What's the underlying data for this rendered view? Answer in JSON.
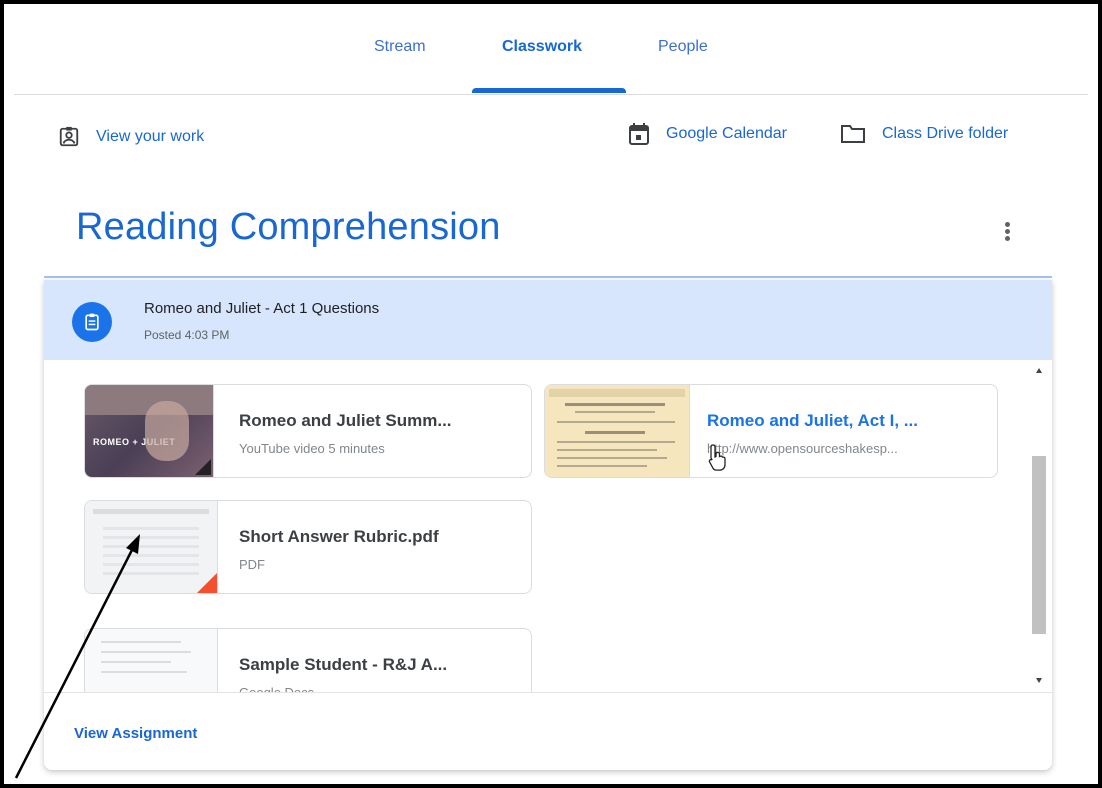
{
  "nav": {
    "tabs": [
      {
        "label": "Stream"
      },
      {
        "label": "Classwork"
      },
      {
        "label": "People"
      }
    ],
    "active_tab": "Classwork"
  },
  "toolbar": {
    "view_work_label": "View your work",
    "calendar_label": "Google Calendar",
    "drive_label": "Class Drive folder"
  },
  "topic": {
    "title": "Reading Comprehension"
  },
  "assignment": {
    "title": "Romeo and Juliet - Act 1 Questions",
    "posted": "Posted 4:03 PM",
    "attachments": [
      {
        "title": "Romeo and Juliet Summ...",
        "subtitle": "YouTube video  5 minutes",
        "kind": "youtube",
        "thumb_text": "ROMEO + JULIET"
      },
      {
        "title": "Romeo and Juliet, Act I, ...",
        "subtitle": "http://www.opensourceshakesp...",
        "kind": "link"
      },
      {
        "title": "Short Answer Rubric.pdf",
        "subtitle": "PDF",
        "kind": "pdf"
      },
      {
        "title": "Sample Student - R&J A...",
        "subtitle": "Google Docs",
        "kind": "doc"
      }
    ],
    "view_label": "View Assignment"
  },
  "colors": {
    "accent": "#1967d2",
    "header_bg": "#d7e6fc",
    "pdf_red": "#f44f2f"
  }
}
